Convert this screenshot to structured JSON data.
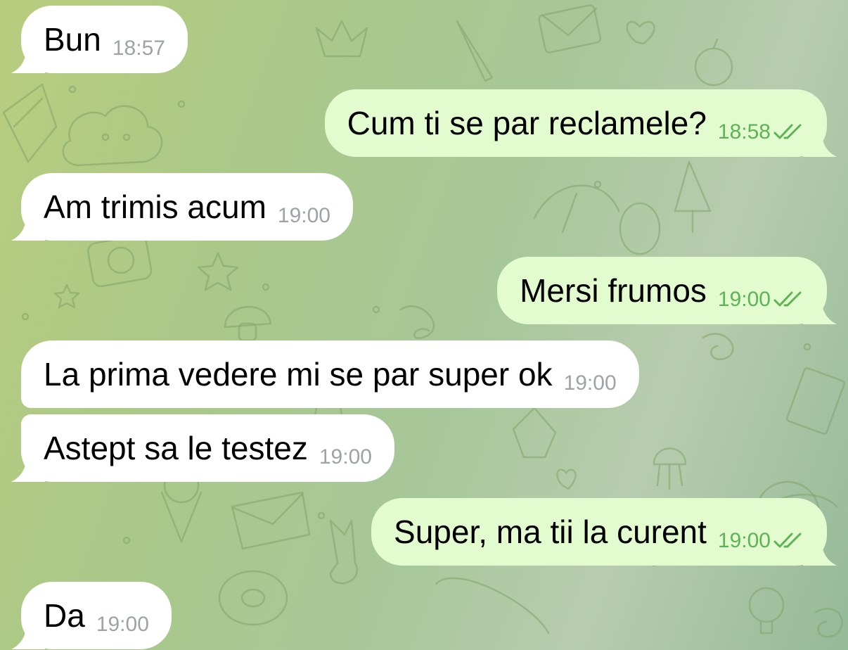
{
  "theme": {
    "incoming_bubble": "#ffffff",
    "outgoing_bubble": "#e2fccf",
    "incoming_time_color": "#9ea3a8",
    "outgoing_time_color": "#5fb255",
    "read_receipt_icon": "double-check-icon"
  },
  "messages": [
    {
      "direction": "incoming",
      "text": "Bun",
      "time": "18:57"
    },
    {
      "direction": "outgoing",
      "text": "Cum ti se par reclamele?",
      "time": "18:58",
      "status": "read"
    },
    {
      "direction": "incoming",
      "text": "Am trimis acum",
      "time": "19:00"
    },
    {
      "direction": "outgoing",
      "text": "Mersi frumos",
      "time": "19:00",
      "status": "read"
    },
    {
      "direction": "incoming",
      "text": "La prima vedere mi se par super ok",
      "time": "19:00"
    },
    {
      "direction": "incoming",
      "text": "Astept sa le testez",
      "time": "19:00"
    },
    {
      "direction": "outgoing",
      "text": "Super, ma tii la curent",
      "time": "19:00",
      "status": "read"
    },
    {
      "direction": "incoming",
      "text": "Da",
      "time": "19:00"
    }
  ]
}
